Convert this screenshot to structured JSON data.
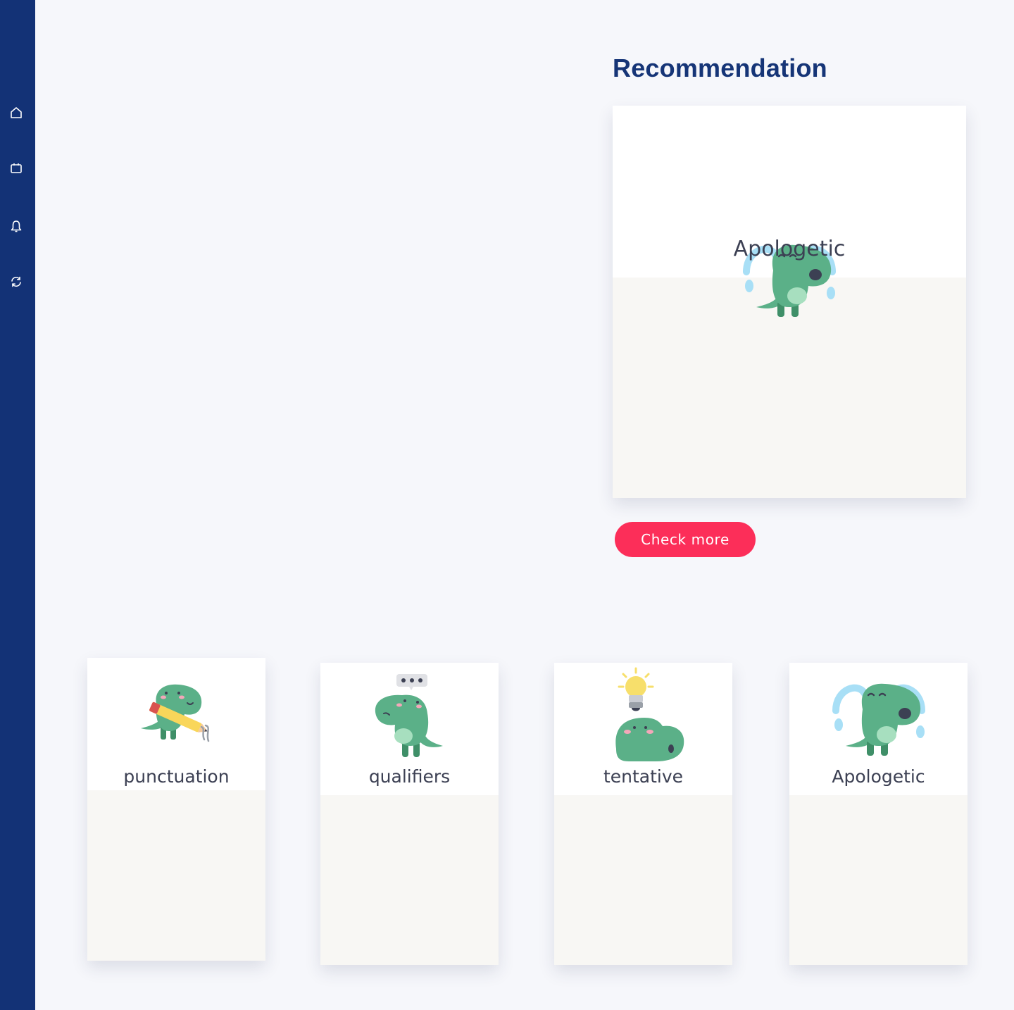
{
  "sidebar": {
    "items": [
      {
        "icon": "home-icon"
      },
      {
        "icon": "calendar-icon"
      },
      {
        "icon": "bell-icon"
      },
      {
        "icon": "refresh-icon"
      }
    ]
  },
  "recommendation": {
    "title": "Recommendation",
    "card": {
      "label": "Apologetic",
      "icon": "crying-dinosaur-icon"
    },
    "button_label": "Check more"
  },
  "cards": [
    {
      "label": "punctuation",
      "icon": "dinosaur-pencil-icon"
    },
    {
      "label": "qualifiers",
      "icon": "dinosaur-thinking-icon"
    },
    {
      "label": "tentative",
      "icon": "dinosaur-lightbulb-icon"
    },
    {
      "label": "Apologetic",
      "icon": "crying-dinosaur-icon"
    }
  ],
  "colors": {
    "sidebar": "#133276",
    "title": "#163577",
    "button": "#fc2e59",
    "dino": "#5bb088"
  }
}
